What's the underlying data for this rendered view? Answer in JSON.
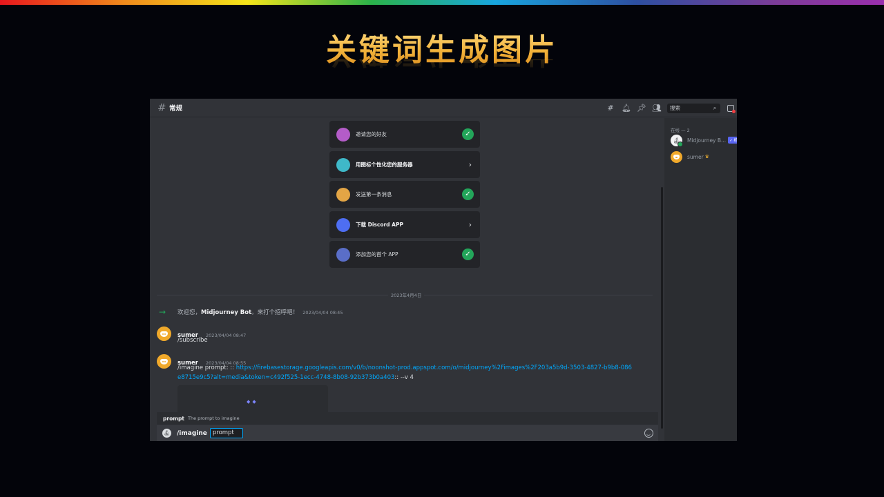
{
  "slide": {
    "title": "关键词生成图片"
  },
  "header": {
    "hash": "#",
    "channel_name": "常规",
    "search_placeholder": "搜索"
  },
  "onboarding": [
    {
      "label": "邀请您的好友",
      "state": "done",
      "color": "#b45cc8"
    },
    {
      "label": "用图标个性化您的服务器",
      "state": "todo",
      "color": "#3fb8c8"
    },
    {
      "label": "发送第一条消息",
      "state": "done",
      "color": "#e3a545"
    },
    {
      "label": "下载 Discord APP",
      "state": "todo",
      "color": "#4e6ef2"
    },
    {
      "label": "添加您的首个 APP",
      "state": "done",
      "color": "#5a6ec8"
    }
  ],
  "chat": {
    "date_divider": "2023年4月4日",
    "join": {
      "prefix": "欢迎您，",
      "name": "Midjourney Bot",
      "suffix": "。来打个招呼吧！",
      "timestamp": "2023/04/04 08:45"
    },
    "messages": [
      {
        "author": "sumer",
        "timestamp": "2023/04/04 08:47",
        "text": "/subscribe"
      },
      {
        "author": "sumer",
        "timestamp": "2023/04/04 08:55",
        "prefix": "/imagine prompt: :: ",
        "link": "https://firebasestorage.googleapis.com/v0/b/noonshot-prod.appspot.com/o/midjourney%2Fimages%2F203a5b9d-3503-4827-b9b8-086e8715e9c5?alt=media&token=c492f525-1ecc-4748-8b08-92b373b0a403",
        "suffix": ":: --v 4"
      }
    ]
  },
  "command_hint": {
    "name": "prompt",
    "description": "The prompt to imagine"
  },
  "composer": {
    "command": "/imagine",
    "option": "prompt"
  },
  "members": {
    "header": "在线 — 2",
    "list": [
      {
        "name": "Midjourney B...",
        "tag": "✓ 机器人",
        "type": "bot"
      },
      {
        "name": "sumer",
        "type": "owner"
      }
    ]
  },
  "colors": {
    "accent_link": "#00a8fc",
    "success": "#23a55a",
    "avatar_orange": "#f0a92b",
    "background": "#313338"
  }
}
